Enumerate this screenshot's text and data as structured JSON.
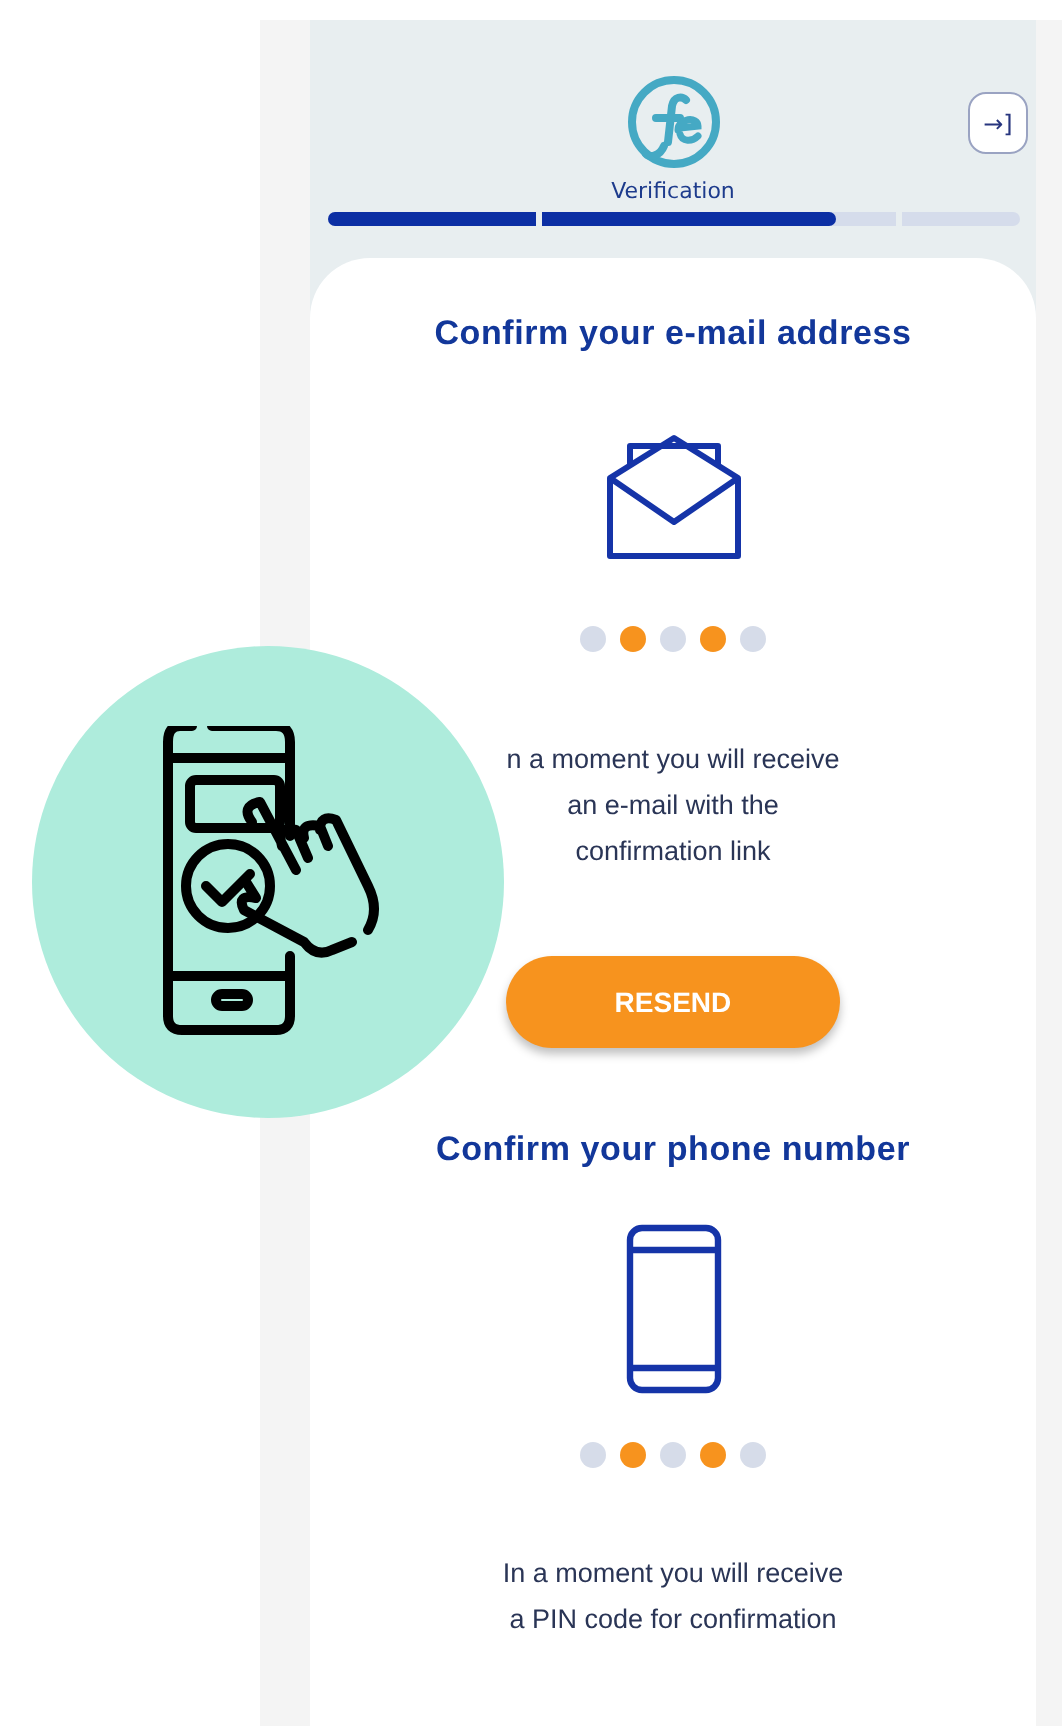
{
  "header": {
    "title": "Verification",
    "exit_button": {
      "label": "→]"
    }
  },
  "progress": {
    "level": 0.735
  },
  "sections": [
    {
      "kind": "email",
      "title": "Confirm your e-mail address",
      "dots": [
        {
          "on": false
        },
        {
          "on": true
        },
        {
          "on": false
        },
        {
          "on": true
        },
        {
          "on": false
        }
      ],
      "message": [
        "n a moment you will receive",
        "an e-mail with the",
        "confirmation link"
      ],
      "button": "RESEND"
    },
    {
      "kind": "phone",
      "title": "Confirm your phone number",
      "dots": [
        {
          "on": false
        },
        {
          "on": true
        },
        {
          "on": false
        },
        {
          "on": true
        },
        {
          "on": false
        }
      ],
      "message": [
        "In a moment you will receive",
        "a PIN code for confirmation"
      ]
    }
  ]
}
